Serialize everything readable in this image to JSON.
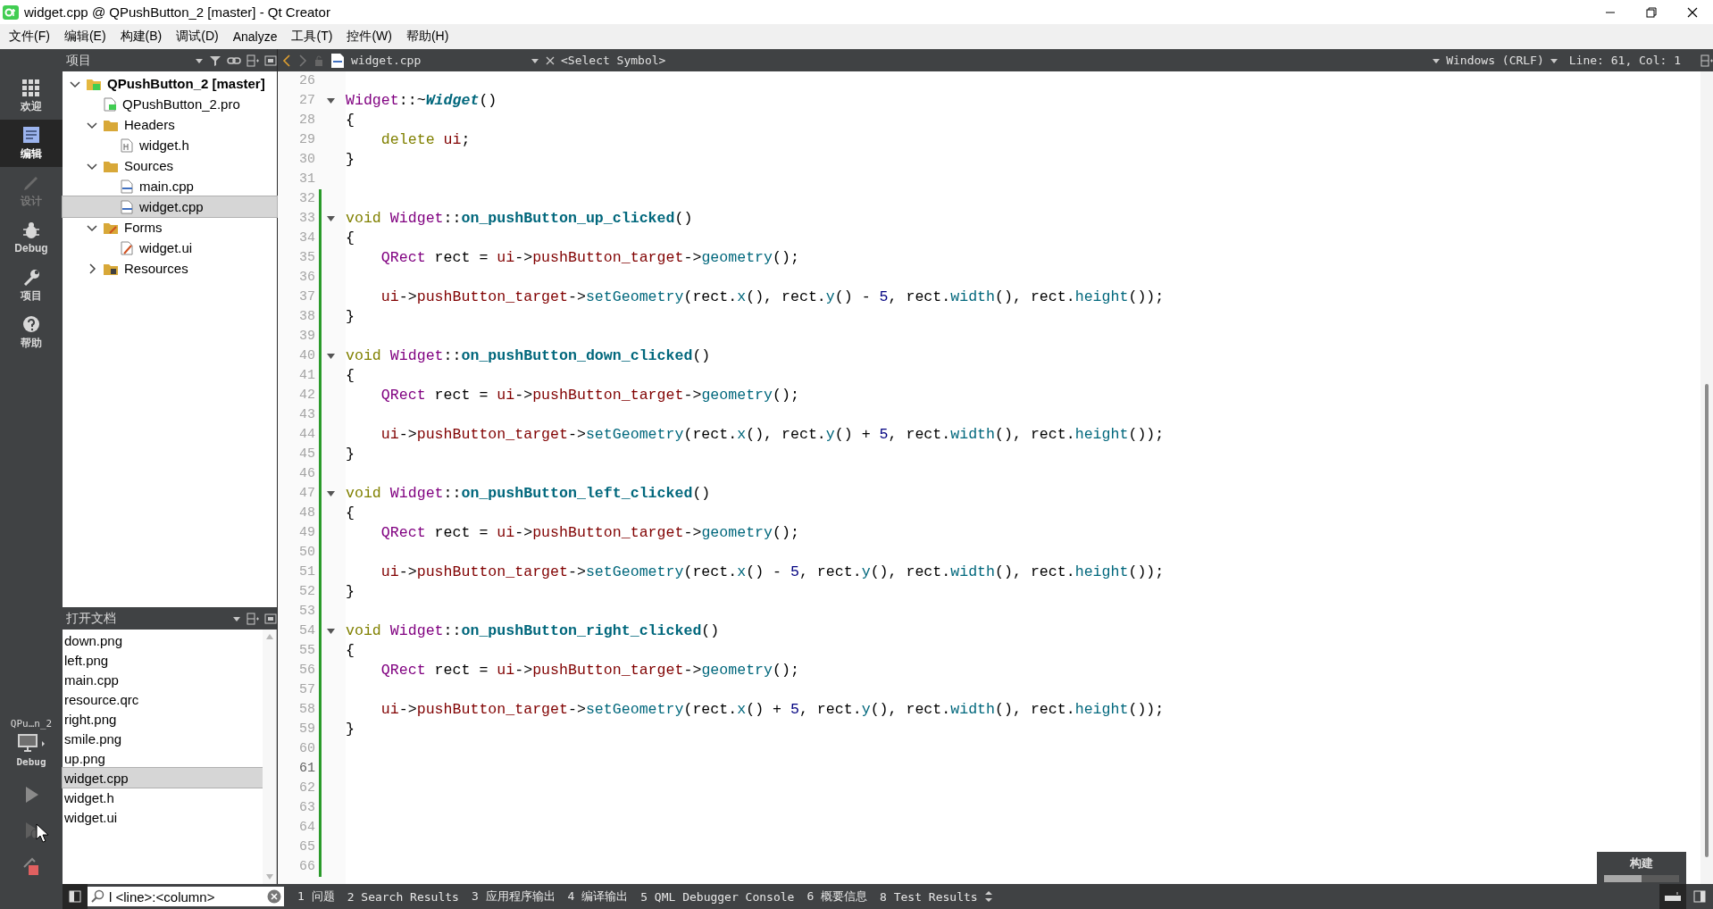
{
  "window": {
    "title": "widget.cpp @ QPushButton_2 [master] - Qt Creator"
  },
  "menu": [
    "文件(F)",
    "编辑(E)",
    "构建(B)",
    "调试(D)",
    "Analyze",
    "工具(T)",
    "控件(W)",
    "帮助(H)"
  ],
  "modes": [
    {
      "label": "欢迎",
      "selected": false,
      "disabled": false
    },
    {
      "label": "编辑",
      "selected": true,
      "disabled": false
    },
    {
      "label": "设计",
      "selected": false,
      "disabled": true
    },
    {
      "label": "Debug",
      "selected": false,
      "disabled": false
    },
    {
      "label": "项目",
      "selected": false,
      "disabled": false
    },
    {
      "label": "帮助",
      "selected": false,
      "disabled": false
    }
  ],
  "kit": {
    "project": "QPu…n_2",
    "build": "Debug"
  },
  "run_buttons": [
    {
      "kind": "run",
      "disabled": false
    },
    {
      "kind": "debug-run",
      "disabled": true
    },
    {
      "kind": "build",
      "disabled": false
    }
  ],
  "projects_panel": {
    "title": "项目",
    "tree": [
      {
        "label": "QPushButton_2 [master]",
        "kind": "project",
        "expanded": true,
        "selected": false,
        "children": [
          {
            "label": "QPushButton_2.pro",
            "kind": "pro",
            "selected": false
          },
          {
            "label": "Headers",
            "kind": "headers",
            "expanded": true,
            "selected": false,
            "children": [
              {
                "label": "widget.h",
                "kind": "header",
                "selected": false
              }
            ]
          },
          {
            "label": "Sources",
            "kind": "sources",
            "expanded": true,
            "selected": false,
            "children": [
              {
                "label": "main.cpp",
                "kind": "source",
                "selected": false
              },
              {
                "label": "widget.cpp",
                "kind": "source",
                "selected": true
              }
            ]
          },
          {
            "label": "Forms",
            "kind": "forms",
            "expanded": true,
            "selected": false,
            "children": [
              {
                "label": "widget.ui",
                "kind": "form",
                "selected": false
              }
            ]
          },
          {
            "label": "Resources",
            "kind": "resources",
            "expanded": false,
            "selected": false
          }
        ]
      }
    ]
  },
  "open_documents": {
    "title": "打开文档",
    "items": [
      {
        "name": "down.png",
        "selected": false
      },
      {
        "name": "left.png",
        "selected": false
      },
      {
        "name": "main.cpp",
        "selected": false
      },
      {
        "name": "resource.qrc",
        "selected": false
      },
      {
        "name": "right.png",
        "selected": false
      },
      {
        "name": "smile.png",
        "selected": false
      },
      {
        "name": "up.png",
        "selected": false
      },
      {
        "name": "widget.cpp",
        "selected": true
      },
      {
        "name": "widget.h",
        "selected": false
      },
      {
        "name": "widget.ui",
        "selected": false
      }
    ]
  },
  "editor": {
    "file": "widget.cpp",
    "symbol": "<Select Symbol>",
    "line_ending": "Windows (CRLF)",
    "position": "Line: 61, Col: 1",
    "lines": [
      {
        "number": "26",
        "fold": false,
        "changed": false,
        "current": false
      },
      {
        "number": "27",
        "fold": true,
        "changed": false,
        "current": false,
        "tokens": [
          {
            "kind": "type",
            "text": "Widget"
          },
          {
            "kind": "plain",
            "text": "::~"
          },
          {
            "kind": "dtor",
            "text": "Widget"
          },
          {
            "kind": "plain",
            "text": "()"
          }
        ]
      },
      {
        "number": "28",
        "fold": false,
        "changed": false,
        "current": false,
        "tokens": [
          {
            "kind": "plain",
            "text": "{"
          }
        ]
      },
      {
        "number": "29",
        "fold": false,
        "changed": false,
        "current": false,
        "tokens": [
          {
            "kind": "keyword",
            "text": "delete"
          },
          {
            "kind": "field",
            "text": "ui"
          },
          {
            "kind": "plain",
            "text": ";"
          }
        ]
      },
      {
        "number": "30",
        "fold": false,
        "changed": false,
        "current": false,
        "tokens": [
          {
            "kind": "plain",
            "text": "}"
          }
        ]
      },
      {
        "number": "31",
        "fold": false,
        "changed": false,
        "current": false
      },
      {
        "number": "32",
        "fold": false,
        "changed": true,
        "current": false
      },
      {
        "number": "33",
        "fold": true,
        "changed": true,
        "current": false,
        "tokens": [
          {
            "kind": "keyword",
            "text": "void"
          },
          {
            "kind": "type",
            "text": "Widget"
          },
          {
            "kind": "plain",
            "text": "::"
          },
          {
            "kind": "func",
            "text": "on_pushButton_up_clicked"
          },
          {
            "kind": "plain",
            "text": "()"
          }
        ]
      },
      {
        "number": "34",
        "fold": false,
        "changed": true,
        "current": false,
        "tokens": [
          {
            "kind": "plain",
            "text": "{"
          }
        ]
      },
      {
        "number": "35",
        "fold": false,
        "changed": true,
        "current": false,
        "tokens": [
          {
            "kind": "type",
            "text": "QRect"
          },
          {
            "kind": "plain",
            "text": " rect = "
          },
          {
            "kind": "field",
            "text": "ui"
          },
          {
            "kind": "plain",
            "text": "->"
          },
          {
            "kind": "field",
            "text": "pushButton_target"
          },
          {
            "kind": "plain",
            "text": "->"
          },
          {
            "kind": "method",
            "text": "geometry"
          },
          {
            "kind": "plain",
            "text": "();"
          }
        ]
      },
      {
        "number": "36",
        "fold": false,
        "changed": true,
        "current": false
      },
      {
        "number": "37",
        "fold": false,
        "changed": true,
        "current": false,
        "tokens": [
          {
            "kind": "field",
            "text": "ui"
          },
          {
            "kind": "plain",
            "text": "->"
          },
          {
            "kind": "field",
            "text": "pushButton_target"
          },
          {
            "kind": "plain",
            "text": "->"
          },
          {
            "kind": "method",
            "text": "setGeometry"
          },
          {
            "kind": "plain",
            "text": "(rect."
          },
          {
            "kind": "method",
            "text": "x"
          },
          {
            "kind": "plain",
            "text": "(), rect."
          },
          {
            "kind": "method",
            "text": "y"
          },
          {
            "kind": "plain",
            "text": "() - "
          },
          {
            "kind": "number",
            "text": "5"
          },
          {
            "kind": "plain",
            "text": ", rect."
          },
          {
            "kind": "method",
            "text": "width"
          },
          {
            "kind": "plain",
            "text": "(), rect."
          },
          {
            "kind": "method",
            "text": "height"
          },
          {
            "kind": "plain",
            "text": "());"
          }
        ]
      },
      {
        "number": "38",
        "fold": false,
        "changed": true,
        "current": false,
        "tokens": [
          {
            "kind": "plain",
            "text": "}"
          }
        ]
      },
      {
        "number": "39",
        "fold": false,
        "changed": true,
        "current": false
      },
      {
        "number": "40",
        "fold": true,
        "changed": true,
        "current": false,
        "tokens": [
          {
            "kind": "keyword",
            "text": "void"
          },
          {
            "kind": "type",
            "text": "Widget"
          },
          {
            "kind": "plain",
            "text": "::"
          },
          {
            "kind": "func",
            "text": "on_pushButton_down_clicked"
          },
          {
            "kind": "plain",
            "text": "()"
          }
        ]
      },
      {
        "number": "41",
        "fold": false,
        "changed": true,
        "current": false,
        "tokens": [
          {
            "kind": "plain",
            "text": "{"
          }
        ]
      },
      {
        "number": "42",
        "fold": false,
        "changed": true,
        "current": false,
        "tokens": [
          {
            "kind": "type",
            "text": "QRect"
          },
          {
            "kind": "plain",
            "text": " rect = "
          },
          {
            "kind": "field",
            "text": "ui"
          },
          {
            "kind": "plain",
            "text": "->"
          },
          {
            "kind": "field",
            "text": "pushButton_target"
          },
          {
            "kind": "plain",
            "text": "->"
          },
          {
            "kind": "method",
            "text": "geometry"
          },
          {
            "kind": "plain",
            "text": "();"
          }
        ]
      },
      {
        "number": "43",
        "fold": false,
        "changed": true,
        "current": false
      },
      {
        "number": "44",
        "fold": false,
        "changed": true,
        "current": false,
        "tokens": [
          {
            "kind": "field",
            "text": "ui"
          },
          {
            "kind": "plain",
            "text": "->"
          },
          {
            "kind": "field",
            "text": "pushButton_target"
          },
          {
            "kind": "plain",
            "text": "->"
          },
          {
            "kind": "method",
            "text": "setGeometry"
          },
          {
            "kind": "plain",
            "text": "(rect."
          },
          {
            "kind": "method",
            "text": "x"
          },
          {
            "kind": "plain",
            "text": "(), rect."
          },
          {
            "kind": "method",
            "text": "y"
          },
          {
            "kind": "plain",
            "text": "() + "
          },
          {
            "kind": "number",
            "text": "5"
          },
          {
            "kind": "plain",
            "text": ", rect."
          },
          {
            "kind": "method",
            "text": "width"
          },
          {
            "kind": "plain",
            "text": "(), rect."
          },
          {
            "kind": "method",
            "text": "height"
          },
          {
            "kind": "plain",
            "text": "());"
          }
        ]
      },
      {
        "number": "45",
        "fold": false,
        "changed": true,
        "current": false,
        "tokens": [
          {
            "kind": "plain",
            "text": "}"
          }
        ]
      },
      {
        "number": "46",
        "fold": false,
        "changed": true,
        "current": false
      },
      {
        "number": "47",
        "fold": true,
        "changed": true,
        "current": false,
        "tokens": [
          {
            "kind": "keyword",
            "text": "void"
          },
          {
            "kind": "type",
            "text": "Widget"
          },
          {
            "kind": "plain",
            "text": "::"
          },
          {
            "kind": "func",
            "text": "on_pushButton_left_clicked"
          },
          {
            "kind": "plain",
            "text": "()"
          }
        ]
      },
      {
        "number": "48",
        "fold": false,
        "changed": true,
        "current": false,
        "tokens": [
          {
            "kind": "plain",
            "text": "{"
          }
        ]
      },
      {
        "number": "49",
        "fold": false,
        "changed": true,
        "current": false,
        "tokens": [
          {
            "kind": "type",
            "text": "QRect"
          },
          {
            "kind": "plain",
            "text": " rect = "
          },
          {
            "kind": "field",
            "text": "ui"
          },
          {
            "kind": "plain",
            "text": "->"
          },
          {
            "kind": "field",
            "text": "pushButton_target"
          },
          {
            "kind": "plain",
            "text": "->"
          },
          {
            "kind": "method",
            "text": "geometry"
          },
          {
            "kind": "plain",
            "text": "();"
          }
        ]
      },
      {
        "number": "50",
        "fold": false,
        "changed": true,
        "current": false
      },
      {
        "number": "51",
        "fold": false,
        "changed": true,
        "current": false,
        "tokens": [
          {
            "kind": "field",
            "text": "ui"
          },
          {
            "kind": "plain",
            "text": "->"
          },
          {
            "kind": "field",
            "text": "pushButton_target"
          },
          {
            "kind": "plain",
            "text": "->"
          },
          {
            "kind": "method",
            "text": "setGeometry"
          },
          {
            "kind": "plain",
            "text": "(rect."
          },
          {
            "kind": "method",
            "text": "x"
          },
          {
            "kind": "plain",
            "text": "() - "
          },
          {
            "kind": "number",
            "text": "5"
          },
          {
            "kind": "plain",
            "text": ", rect."
          },
          {
            "kind": "method",
            "text": "y"
          },
          {
            "kind": "plain",
            "text": "(), rect."
          },
          {
            "kind": "method",
            "text": "width"
          },
          {
            "kind": "plain",
            "text": "(), rect."
          },
          {
            "kind": "method",
            "text": "height"
          },
          {
            "kind": "plain",
            "text": "());"
          }
        ]
      },
      {
        "number": "52",
        "fold": false,
        "changed": true,
        "current": false,
        "tokens": [
          {
            "kind": "plain",
            "text": "}"
          }
        ]
      },
      {
        "number": "53",
        "fold": false,
        "changed": true,
        "current": false
      },
      {
        "number": "54",
        "fold": true,
        "changed": true,
        "current": false,
        "tokens": [
          {
            "kind": "keyword",
            "text": "void"
          },
          {
            "kind": "type",
            "text": "Widget"
          },
          {
            "kind": "plain",
            "text": "::"
          },
          {
            "kind": "func",
            "text": "on_pushButton_right_clicked"
          },
          {
            "kind": "plain",
            "text": "()"
          }
        ]
      },
      {
        "number": "55",
        "fold": false,
        "changed": true,
        "current": false,
        "tokens": [
          {
            "kind": "plain",
            "text": "{"
          }
        ]
      },
      {
        "number": "56",
        "fold": false,
        "changed": true,
        "current": false,
        "tokens": [
          {
            "kind": "type",
            "text": "QRect"
          },
          {
            "kind": "plain",
            "text": " rect = "
          },
          {
            "kind": "field",
            "text": "ui"
          },
          {
            "kind": "plain",
            "text": "->"
          },
          {
            "kind": "field",
            "text": "pushButton_target"
          },
          {
            "kind": "plain",
            "text": "->"
          },
          {
            "kind": "method",
            "text": "geometry"
          },
          {
            "kind": "plain",
            "text": "();"
          }
        ]
      },
      {
        "number": "57",
        "fold": false,
        "changed": true,
        "current": false
      },
      {
        "number": "58",
        "fold": false,
        "changed": true,
        "current": false,
        "tokens": [
          {
            "kind": "field",
            "text": "ui"
          },
          {
            "kind": "plain",
            "text": "->"
          },
          {
            "kind": "field",
            "text": "pushButton_target"
          },
          {
            "kind": "plain",
            "text": "->"
          },
          {
            "kind": "method",
            "text": "setGeometry"
          },
          {
            "kind": "plain",
            "text": "(rect."
          },
          {
            "kind": "method",
            "text": "x"
          },
          {
            "kind": "plain",
            "text": "() + "
          },
          {
            "kind": "number",
            "text": "5"
          },
          {
            "kind": "plain",
            "text": ", rect."
          },
          {
            "kind": "method",
            "text": "y"
          },
          {
            "kind": "plain",
            "text": "(), rect."
          },
          {
            "kind": "method",
            "text": "width"
          },
          {
            "kind": "plain",
            "text": "(), rect."
          },
          {
            "kind": "method",
            "text": "height"
          },
          {
            "kind": "plain",
            "text": "());"
          }
        ]
      },
      {
        "number": "59",
        "fold": false,
        "changed": true,
        "current": false,
        "tokens": [
          {
            "kind": "plain",
            "text": "}"
          }
        ]
      },
      {
        "number": "60",
        "fold": false,
        "changed": true,
        "current": false
      },
      {
        "number": "61",
        "fold": false,
        "changed": true,
        "current": true
      },
      {
        "number": "62",
        "fold": false,
        "changed": true,
        "current": false
      },
      {
        "number": "63",
        "fold": false,
        "changed": true,
        "current": false
      },
      {
        "number": "64",
        "fold": false,
        "changed": true,
        "current": false
      },
      {
        "number": "65",
        "fold": false,
        "changed": true,
        "current": false
      },
      {
        "number": "66",
        "fold": false,
        "changed": true,
        "current": false
      }
    ]
  },
  "locator": {
    "placeholder": "l <line>:<column>"
  },
  "output_tabs": [
    "1 问题",
    "2 Search Results",
    "3 应用程序输出",
    "4 编译输出",
    "5 QML Debugger Console",
    "6 概要信息",
    "8 Test Results"
  ],
  "build_progress": {
    "title": "构建",
    "level": 0.5
  }
}
